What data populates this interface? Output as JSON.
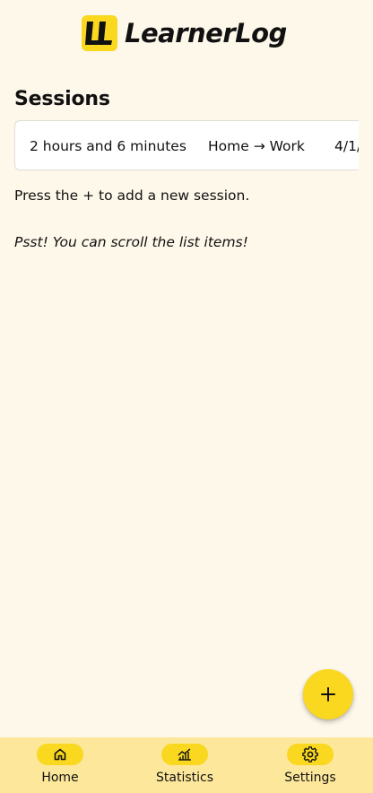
{
  "app": {
    "name": "LearnerLog"
  },
  "main": {
    "title": "Sessions",
    "sessions": [
      {
        "duration": "2 hours and 6 minutes",
        "route": "Home → Work",
        "date": "4/1/"
      }
    ],
    "hint_add": "Press the + to add a new session.",
    "hint_scroll": "Psst! You can scroll the list items!"
  },
  "fab": {
    "icon": "plus-icon"
  },
  "nav": {
    "items": [
      {
        "label": "Home",
        "icon": "home-icon",
        "active": true
      },
      {
        "label": "Statistics",
        "icon": "chart-icon",
        "active": false
      },
      {
        "label": "Settings",
        "icon": "gear-icon",
        "active": false
      }
    ]
  },
  "colors": {
    "background": "#fef8ea",
    "accent": "#f9d81f",
    "nav_background": "#fde79b",
    "card_background": "#ffffff",
    "text": "#111111"
  }
}
